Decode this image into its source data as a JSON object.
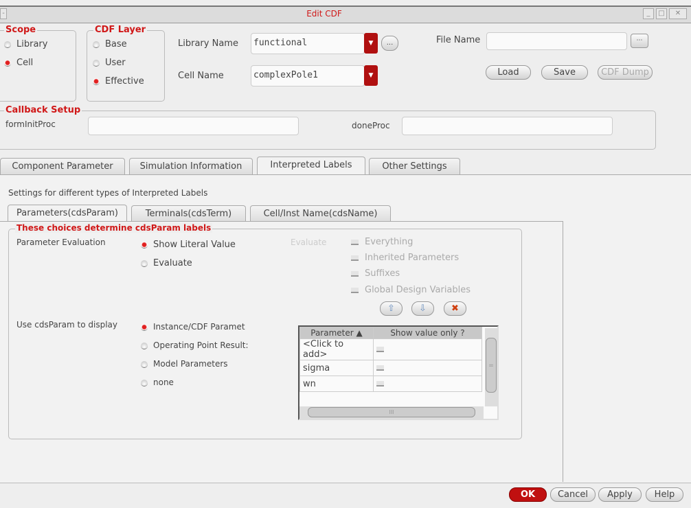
{
  "window": {
    "title": "Edit CDF",
    "min": "_",
    "max": "□",
    "close": "✕"
  },
  "scope": {
    "label": "Scope",
    "options": [
      "Library",
      "Cell"
    ],
    "selected": 1
  },
  "cdf_layer": {
    "label": "CDF Layer",
    "options": [
      "Base",
      "User",
      "Effective"
    ],
    "selected": 2
  },
  "library": {
    "label": "Library Name",
    "value": "functional",
    "browse": "..."
  },
  "cell": {
    "label": "Cell Name",
    "value": "complexPole1"
  },
  "file": {
    "label": "File Name",
    "value": "",
    "load": "Load",
    "save": "Save",
    "dump": "CDF Dump"
  },
  "callback": {
    "label": "Callback Setup",
    "init_label": "formInitProc",
    "init_value": "",
    "done_label": "doneProc",
    "done_value": ""
  },
  "tabs": [
    "Component Parameter",
    "Simulation Information",
    "Interpreted Labels",
    "Other Settings"
  ],
  "settings_text": "Settings for different types of Interpreted Labels",
  "subtabs": [
    "Parameters(cdsParam)",
    "Terminals(cdsTerm)",
    "Cell/Inst Name(cdsName)"
  ],
  "choices": {
    "label": "These choices determine cdsParam labels",
    "eval_label": "Parameter Evaluation",
    "eval_options": [
      "Show Literal Value",
      "Evaluate"
    ],
    "evaluate_label": "Evaluate",
    "evaluate_checks": [
      "Everything",
      "Inherited Parameters",
      "Suffixes",
      "Global Design Variables"
    ],
    "display_label": "Use cdsParam to display",
    "display_options": [
      "Instance/CDF Paramet",
      "Operating Point Result:",
      "Model Parameters",
      "none"
    ]
  },
  "table": {
    "headers": [
      "Parameter ▲",
      "Show value only ?"
    ],
    "rows": [
      "<Click to add>",
      "sigma",
      "wn"
    ],
    "hscroll": "III",
    "vscroll": "="
  },
  "buttons": {
    "ok": "OK",
    "cancel": "Cancel",
    "apply": "Apply",
    "help": "Help"
  },
  "colors": {
    "accent": "#d01818"
  }
}
